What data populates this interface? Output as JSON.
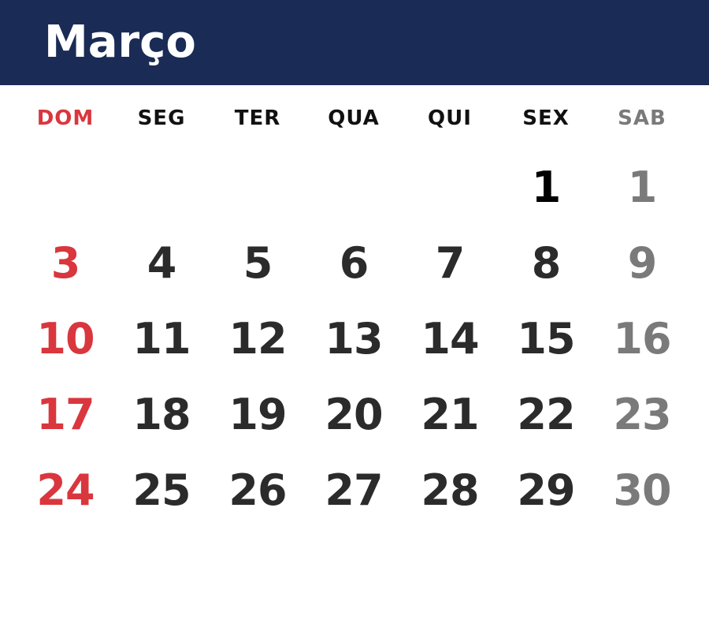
{
  "calendar": {
    "month": "Março",
    "colors": {
      "header_bg": "#1a2b55",
      "header_text": "#ffffff",
      "sunday": "#d9363e",
      "weekday": "#2b2b2b",
      "weekday_header": "#111111",
      "saturday": "#7a7a7a",
      "first_friday": "#000000"
    },
    "weekdays": [
      "DOM",
      "SEG",
      "TER",
      "QUA",
      "QUI",
      "SEX",
      "SAB"
    ],
    "weeks": [
      [
        "",
        "",
        "",
        "",
        "",
        "1",
        "1"
      ],
      [
        "3",
        "4",
        "5",
        "6",
        "7",
        "8",
        "9"
      ],
      [
        "10",
        "11",
        "12",
        "13",
        "14",
        "15",
        "16"
      ],
      [
        "17",
        "18",
        "19",
        "20",
        "21",
        "22",
        "23"
      ],
      [
        "24",
        "25",
        "26",
        "27",
        "28",
        "29",
        "30"
      ]
    ]
  }
}
